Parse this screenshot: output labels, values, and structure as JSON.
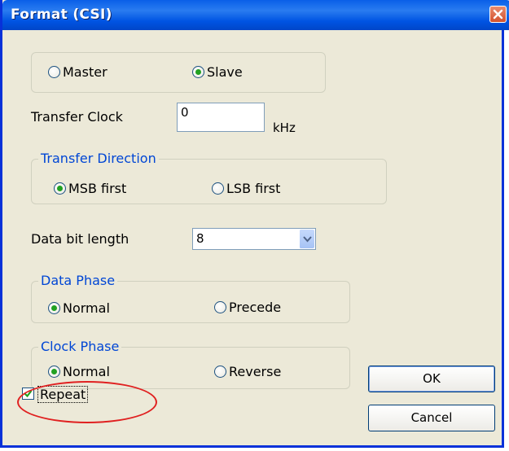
{
  "window": {
    "title": "Format (CSI)"
  },
  "mode": {
    "options": [
      {
        "label": "Master",
        "selected": false
      },
      {
        "label": "Slave",
        "selected": true
      }
    ]
  },
  "transfer_clock": {
    "label": "Transfer Clock",
    "value": "0",
    "unit": "kHz"
  },
  "transfer_direction": {
    "legend": "Transfer Direction",
    "options": [
      {
        "label": "MSB first",
        "selected": true
      },
      {
        "label": "LSB first",
        "selected": false
      }
    ]
  },
  "data_bit_length": {
    "label": "Data bit length",
    "value": "8"
  },
  "data_phase": {
    "legend": "Data Phase",
    "options": [
      {
        "label": "Normal",
        "selected": true
      },
      {
        "label": "Precede",
        "selected": false
      }
    ]
  },
  "clock_phase": {
    "legend": "Clock Phase",
    "options": [
      {
        "label": "Normal",
        "selected": true
      },
      {
        "label": "Reverse",
        "selected": false
      }
    ]
  },
  "repeat": {
    "label": "Repeat",
    "checked": true
  },
  "buttons": {
    "ok": "OK",
    "cancel": "Cancel"
  },
  "colors": {
    "title_bar": "#0054E3",
    "legend_text": "#0046D5",
    "radio_selected": "#21A121",
    "highlight": "#E02020"
  }
}
